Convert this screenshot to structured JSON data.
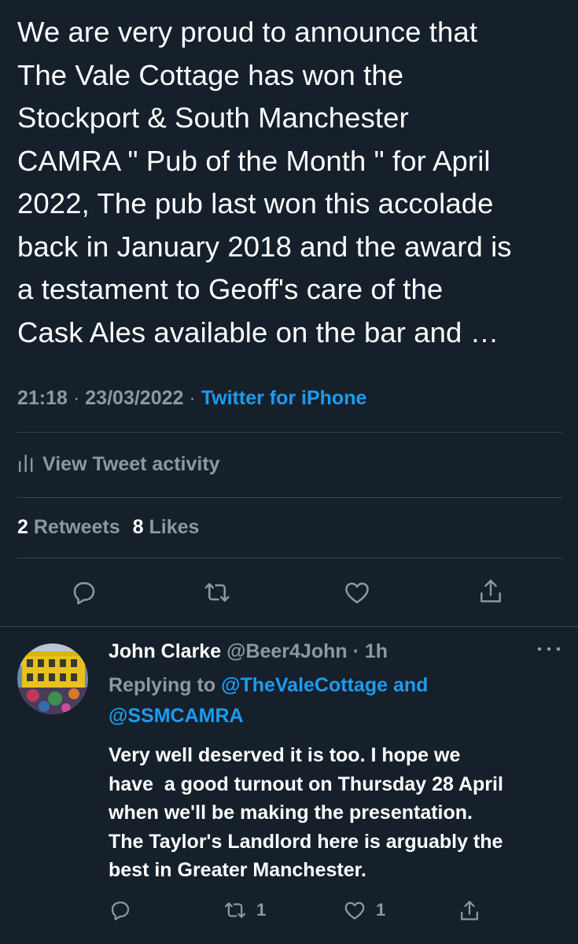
{
  "tweet": {
    "text_lines": [
      "We are very proud to announce that",
      "The Vale Cottage has won the",
      "Stockport & South Manchester",
      "CAMRA \" Pub of the Month \" for April",
      "2022, The pub last won this accolade",
      "back in January 2018 and the award is",
      "a testament to Geoff's care of the",
      "Cask Ales available on the bar and …"
    ],
    "time": "21:18",
    "date": "23/03/2022",
    "separator": "·",
    "source": "Twitter for iPhone",
    "activity_label": "View Tweet activity",
    "retweets_count": "2",
    "retweets_label": "Retweets",
    "likes_count": "8",
    "likes_label": "Likes"
  },
  "reply": {
    "name": "John Clarke",
    "handle": "@Beer4John",
    "separator": "·",
    "time": "1h",
    "replying_prefix": "Replying to",
    "replying_to_1": "@TheValeCottage",
    "replying_and": "and",
    "replying_to_2": "@SSMCAMRA",
    "text_lines": [
      "Very well deserved it is too. I hope we",
      "have  a good turnout on Thursday 28 April",
      "when we'll be making the presentation.",
      "The Taylor's Landlord here is arguably the",
      "best in Greater Manchester."
    ],
    "retweet_count": "1",
    "like_count": "1"
  },
  "icons": {
    "activity": "bar-chart-icon",
    "reply": "speech-bubble-icon",
    "retweet": "retweet-icon",
    "like": "heart-icon",
    "share": "share-icon",
    "more": "more-dots-icon"
  },
  "colors": {
    "background": "#15202b",
    "text": "#ffffff",
    "secondary": "#8b98a5",
    "accent": "#1d9bf0",
    "divider": "#38444d"
  }
}
